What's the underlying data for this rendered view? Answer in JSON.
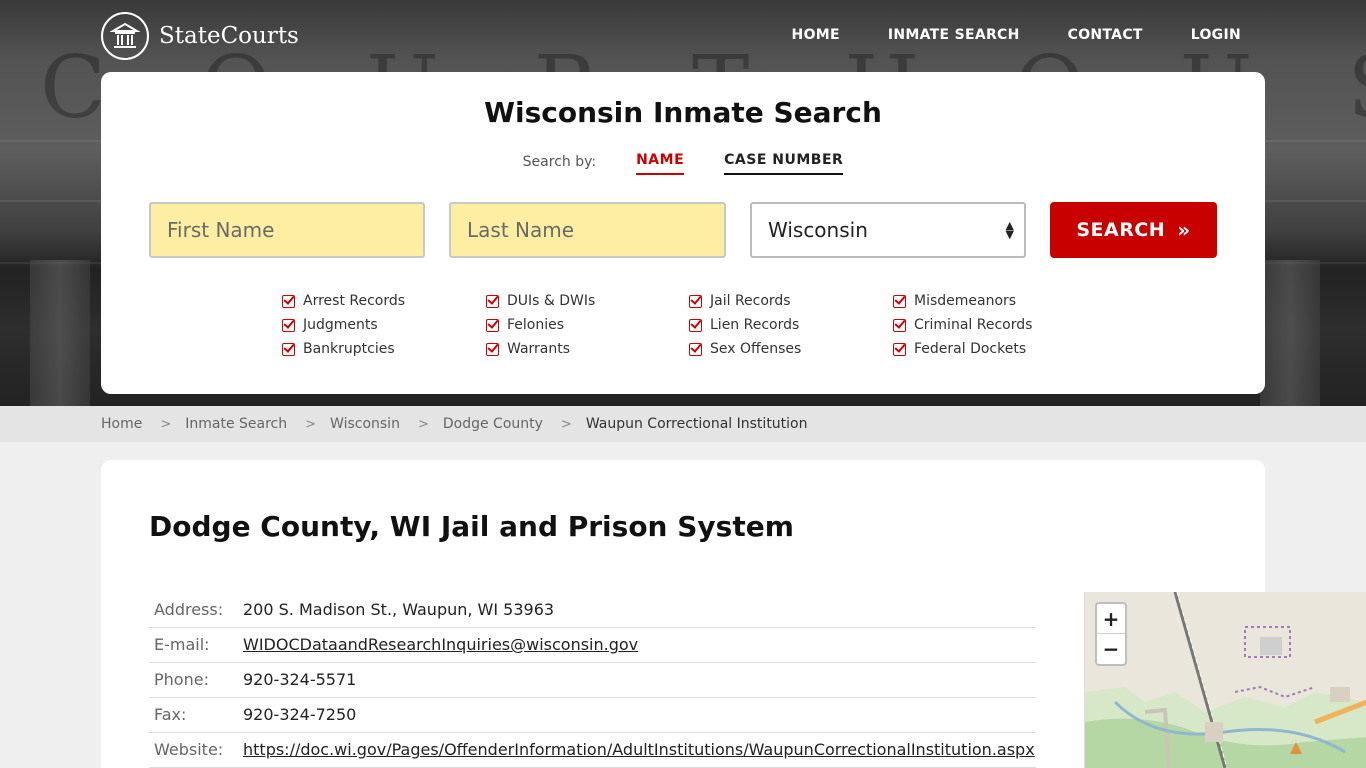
{
  "brand": {
    "name": "StateCourts"
  },
  "nav": {
    "home": "HOME",
    "inmate_search": "INMATE SEARCH",
    "contact": "CONTACT",
    "login": "LOGIN"
  },
  "search": {
    "title": "Wisconsin Inmate Search",
    "search_by_label": "Search by:",
    "tab_name": "NAME",
    "tab_case": "CASE NUMBER",
    "first_name_placeholder": "First Name",
    "last_name_placeholder": "Last Name",
    "state_value": "Wisconsin",
    "button_label": "SEARCH",
    "record_types": [
      "Arrest Records",
      "DUIs & DWIs",
      "Jail Records",
      "Misdemeanors",
      "Judgments",
      "Felonies",
      "Lien Records",
      "Criminal Records",
      "Bankruptcies",
      "Warrants",
      "Sex Offenses",
      "Federal Dockets"
    ]
  },
  "breadcrumb": [
    "Home",
    "Inmate Search",
    "Wisconsin",
    "Dodge County",
    "Waupun Correctional Institution"
  ],
  "content": {
    "heading": "Dodge County, WI Jail and Prison System",
    "rows": [
      {
        "key": "Address:",
        "value": "200 S. Madison St., Waupun, WI 53963"
      },
      {
        "key": "E-mail:",
        "value": "WIDOCDataandResearchInquiries@wisconsin.gov"
      },
      {
        "key": "Phone:",
        "value": "920-324-5571"
      },
      {
        "key": "Fax:",
        "value": "920-324-7250"
      },
      {
        "key": "Website:",
        "value": "https://doc.wi.gov/Pages/OffenderInformation/AdultInstitutions/WaupunCorrectionalInstitution.aspx"
      }
    ]
  },
  "map": {
    "zoom_in": "+",
    "zoom_out": "−"
  },
  "colors": {
    "accent": "#c80000",
    "input_fill": "#fdeea2"
  }
}
